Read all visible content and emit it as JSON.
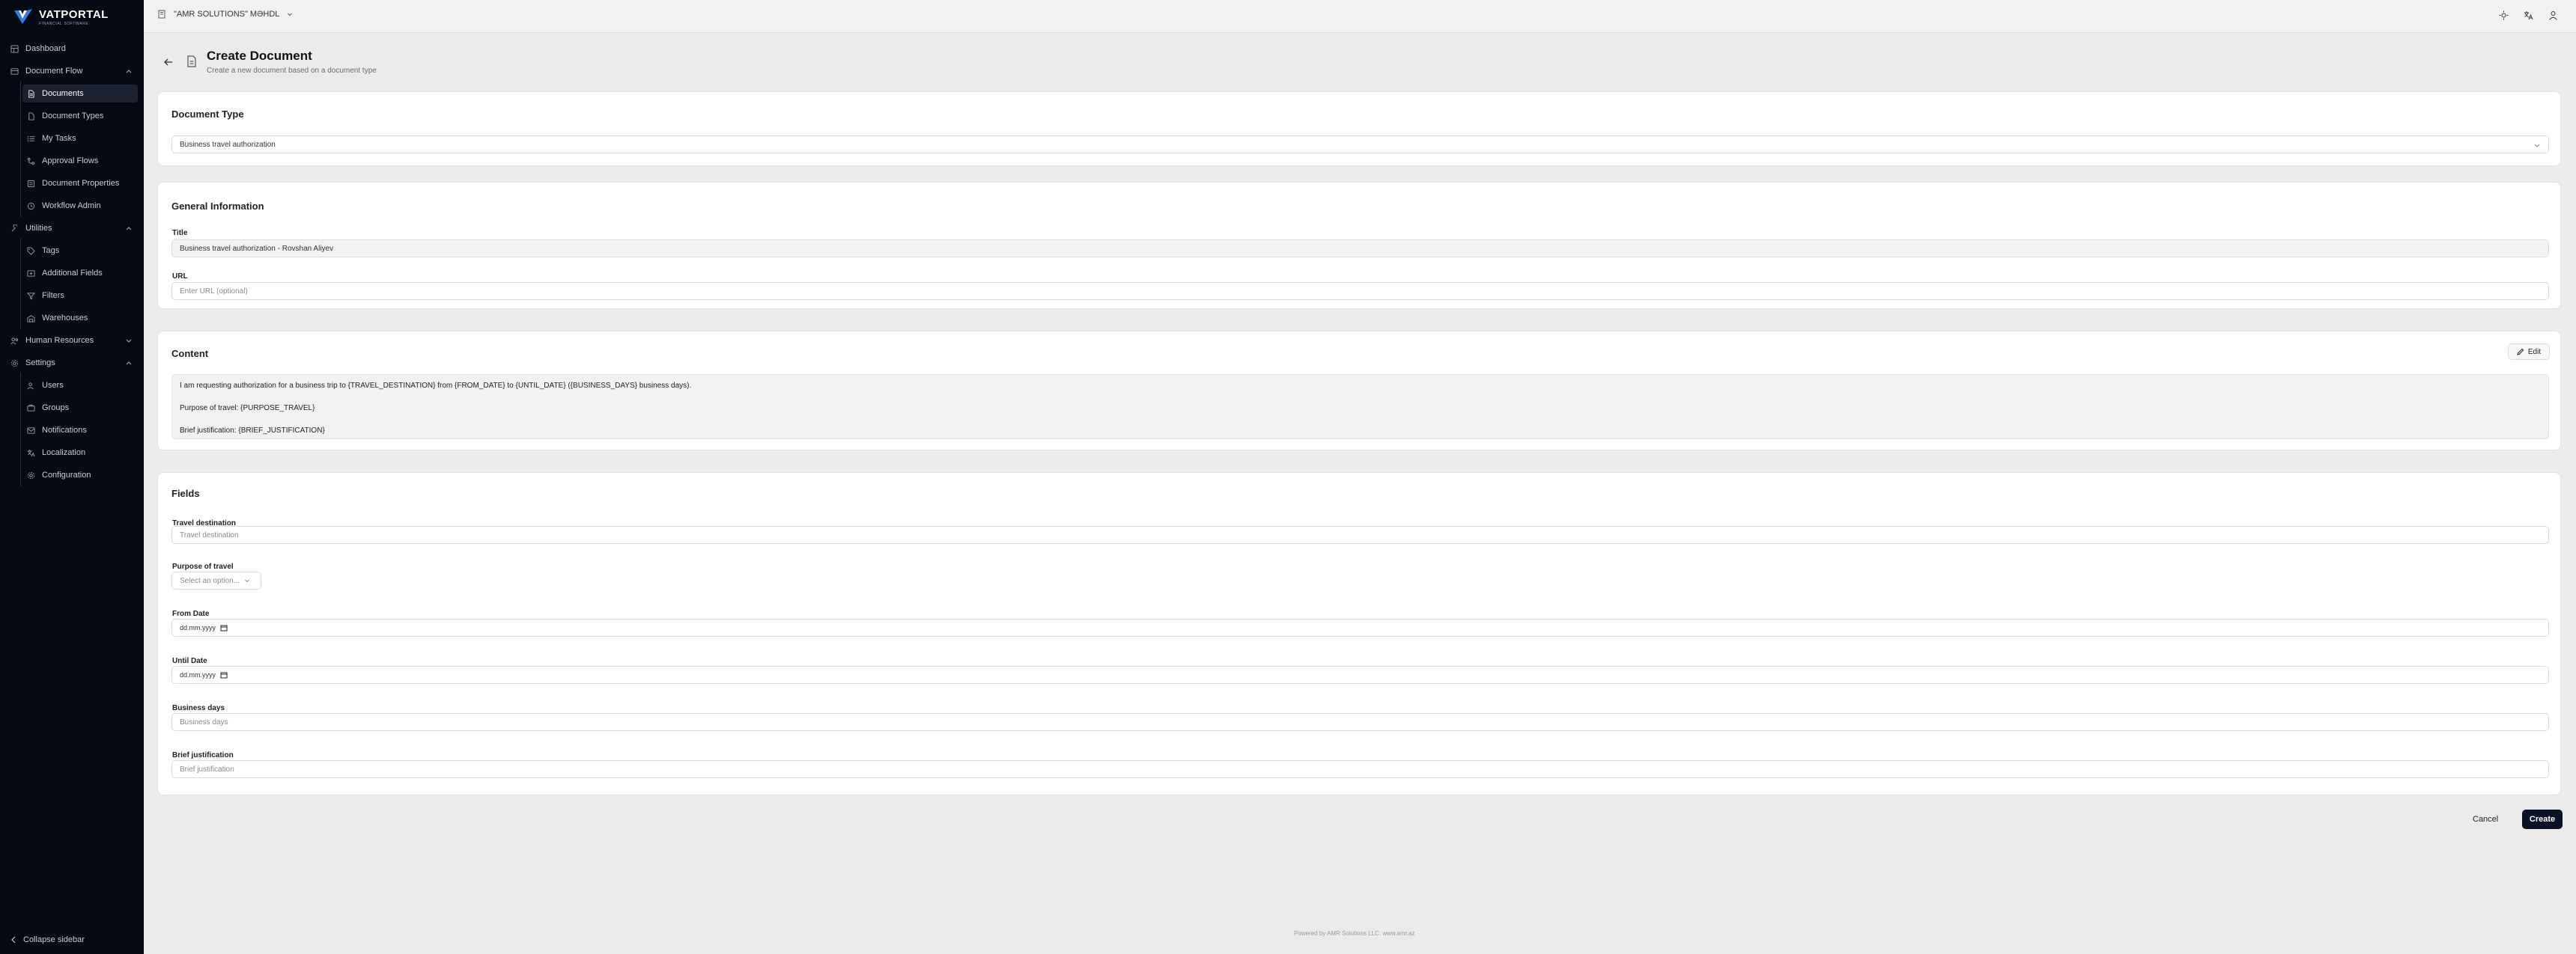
{
  "app": {
    "logo_name": "VATPORTAL",
    "logo_sub": "FINANCIAL SOFTWARE"
  },
  "sidebar": {
    "items": [
      {
        "label": "Dashboard",
        "icon": "dashboard-icon"
      },
      {
        "label": "Document Flow",
        "icon": "document-flow-icon"
      },
      {
        "label": "Documents",
        "icon": "document-icon"
      },
      {
        "label": "Document Types",
        "icon": "document-type-icon"
      },
      {
        "label": "My Tasks",
        "icon": "tasks-icon"
      },
      {
        "label": "Approval Flows",
        "icon": "flow-icon"
      },
      {
        "label": "Document Properties",
        "icon": "properties-icon"
      },
      {
        "label": "Workflow Admin",
        "icon": "workflow-icon"
      },
      {
        "label": "Utilities",
        "icon": "utilities-icon"
      },
      {
        "label": "Tags",
        "icon": "tag-icon"
      },
      {
        "label": "Additional Fields",
        "icon": "fields-icon"
      },
      {
        "label": "Filters",
        "icon": "filter-icon"
      },
      {
        "label": "Warehouses",
        "icon": "warehouse-icon"
      },
      {
        "label": "Human Resources",
        "icon": "hr-icon"
      },
      {
        "label": "Settings",
        "icon": "settings-icon"
      },
      {
        "label": "Users",
        "icon": "users-icon"
      },
      {
        "label": "Groups",
        "icon": "groups-icon"
      },
      {
        "label": "Notifications",
        "icon": "notifications-icon"
      },
      {
        "label": "Localization",
        "icon": "localization-icon"
      },
      {
        "label": "Configuration",
        "icon": "configuration-icon"
      }
    ],
    "collapse_label": "Collapse sidebar"
  },
  "topbar": {
    "company": "\"AMR SOLUTIONS\" MƏHDL"
  },
  "page": {
    "title": "Create Document",
    "subtitle": "Create a new document based on a document type"
  },
  "doc_type": {
    "title": "Document Type",
    "value": "Business travel authorization"
  },
  "general": {
    "title": "General Information",
    "title_label": "Title",
    "title_value": "Business travel authorization - Rovshan Aliyev",
    "url_label": "URL",
    "url_placeholder": "Enter URL (optional)"
  },
  "content": {
    "title": "Content",
    "edit_label": "Edit",
    "line1": "I am requesting authorization for a business trip to {TRAVEL_DESTINATION} from {FROM_DATE} to {UNTIL_DATE} ({BUSINESS_DAYS} business days).",
    "line2": "Purpose of travel: {PURPOSE_TRAVEL}",
    "line3": "Brief justification: {BRIEF_JUSTIFICATION}"
  },
  "fields": {
    "title": "Fields",
    "travel_destination_label": "Travel destination",
    "travel_destination_placeholder": "Travel destination",
    "purpose_label": "Purpose of travel",
    "purpose_placeholder": "Select an option...",
    "from_label": "From Date",
    "from_placeholder": "dd.mm.yyyy",
    "until_label": "Until Date",
    "until_placeholder": "dd.mm.yyyy",
    "business_days_label": "Business days",
    "business_days_placeholder": "Business days",
    "justification_label": "Brief justification",
    "justification_placeholder": "Brief justification"
  },
  "actions": {
    "cancel": "Cancel",
    "create": "Create"
  },
  "footer": "Powered by AMR Solutions LLC. www.amr.az"
}
